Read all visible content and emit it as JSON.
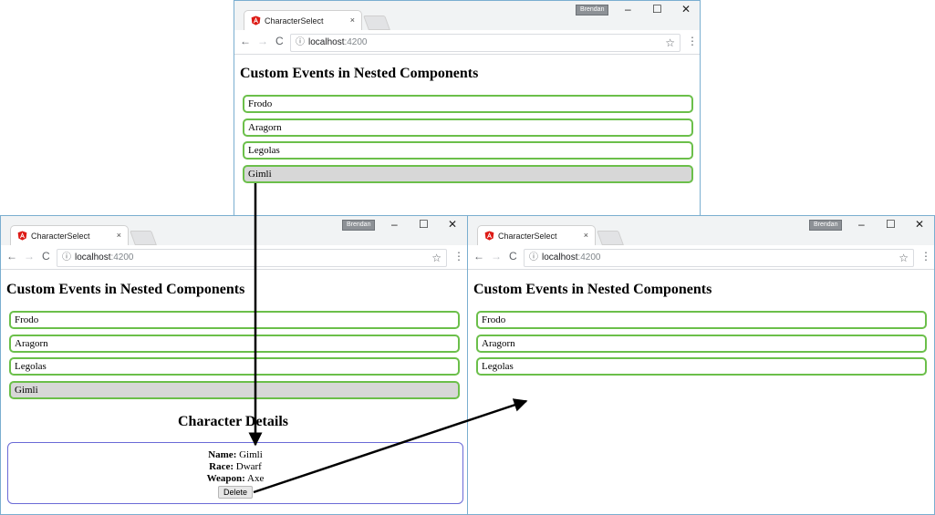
{
  "browser": {
    "tab_title": "CharacterSelect",
    "tab_close": "×",
    "profile": "Brendan",
    "url_host": "localhost",
    "url_port": ":4200",
    "nav_back": "←",
    "nav_forward": "→",
    "nav_reload": "C",
    "info_glyph": "ⓘ",
    "star_glyph": "☆",
    "menu_glyph": "⋮",
    "minimize": "–",
    "maximize": "☐",
    "close": "✕"
  },
  "page": {
    "heading": "Custom Events in Nested Components"
  },
  "characters": [
    "Frodo",
    "Aragorn",
    "Legolas",
    "Gimli"
  ],
  "remaining_characters": [
    "Frodo",
    "Aragorn",
    "Legolas"
  ],
  "details": {
    "title": "Character Details",
    "name_label": "Name:",
    "name_value": "Gimli",
    "race_label": "Race:",
    "race_value": "Dwarf",
    "weapon_label": "Weapon:",
    "weapon_value": "Axe",
    "delete_label": "Delete"
  },
  "colors": {
    "item_border": "#6bbf4a",
    "selected_bg": "#d7d7d7",
    "details_border": "#6a6ad6",
    "window_border": "#7aaed0"
  }
}
